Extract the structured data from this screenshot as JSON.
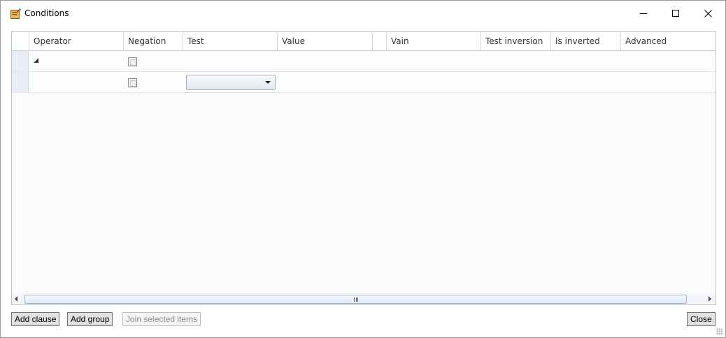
{
  "window": {
    "title": "Conditions"
  },
  "grid": {
    "columns": [
      "Operator",
      "Negation",
      "Test",
      "Value",
      "",
      "Vain",
      "Test inversion",
      "Is inverted",
      "Advanced"
    ],
    "rows": [
      {
        "operator": "",
        "negation": false,
        "test": ""
      },
      {
        "operator": "",
        "negation": false,
        "test": ""
      }
    ]
  },
  "buttons": {
    "add_clause": "Add clause",
    "add_group": "Add group",
    "join_selected": "Join selected items",
    "close": "Close"
  }
}
